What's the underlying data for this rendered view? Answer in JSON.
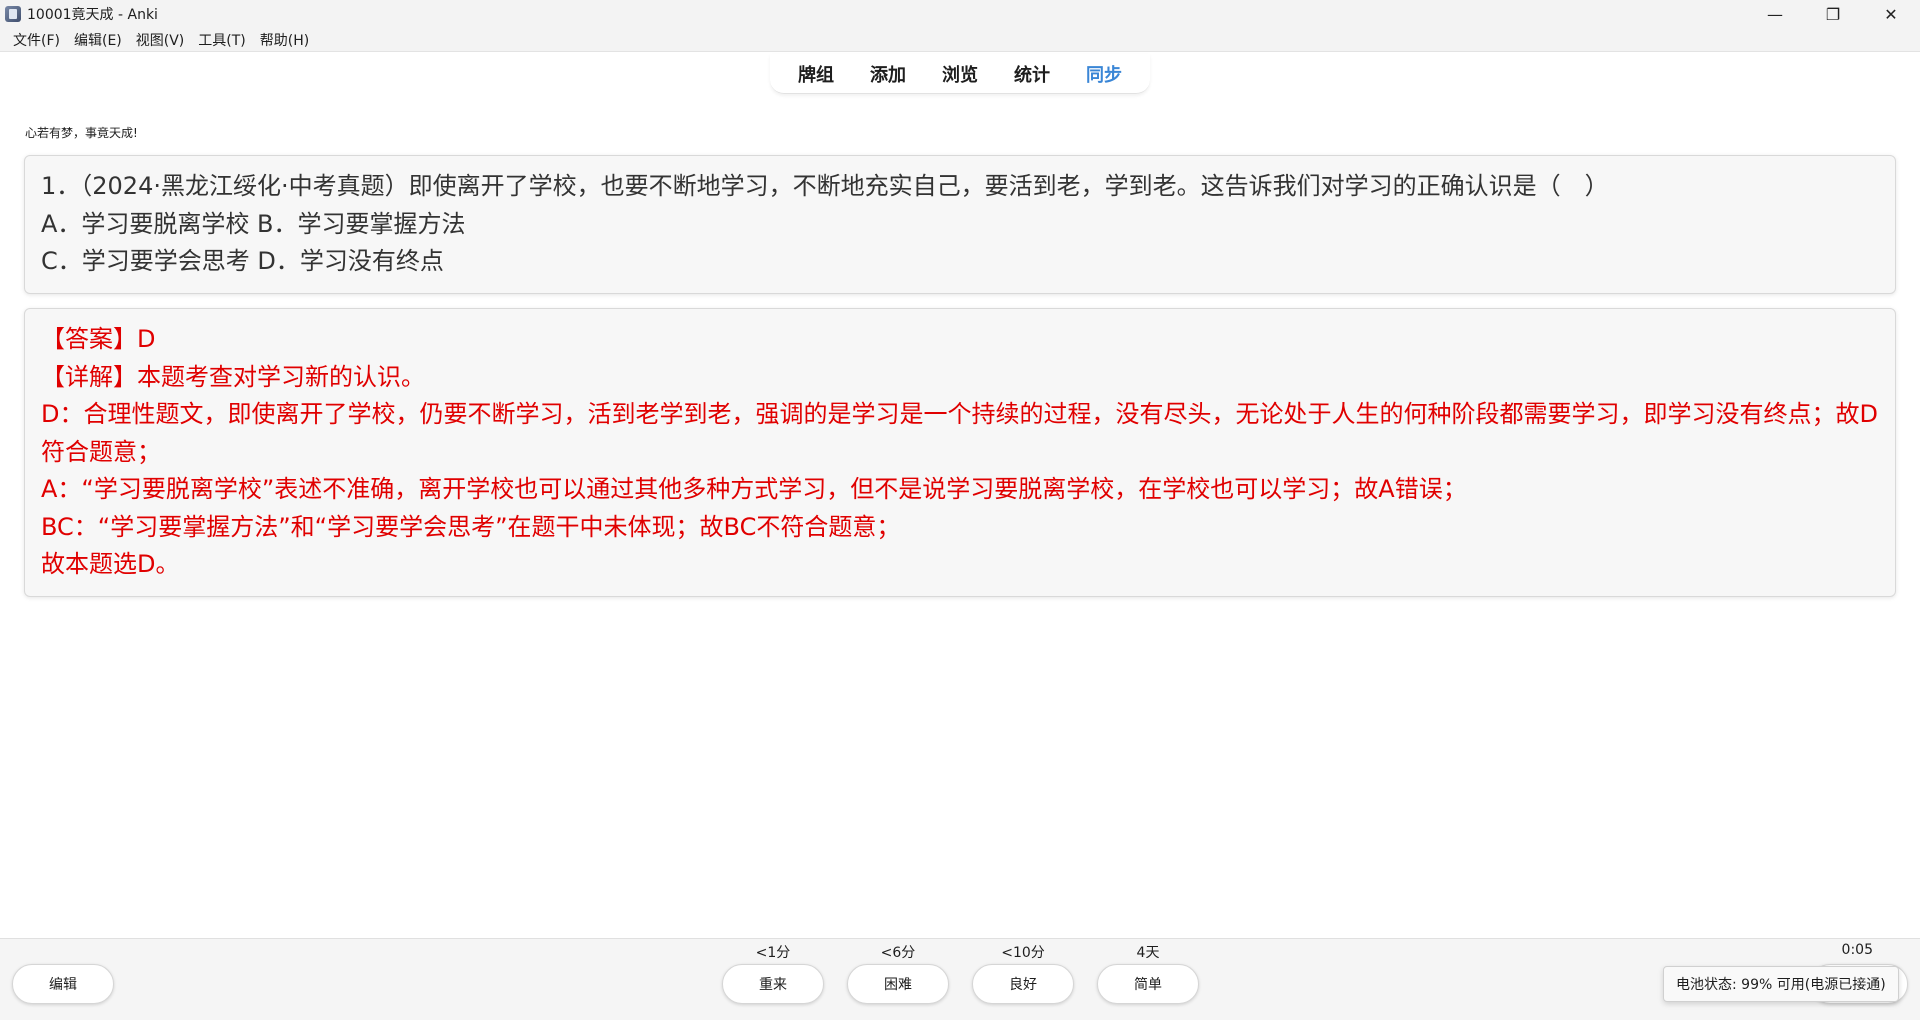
{
  "window": {
    "title": "10001竟天成 - Anki",
    "controls": {
      "minimize": "—",
      "restore": "❐",
      "close": "✕"
    }
  },
  "menu": [
    "文件(F)",
    "编辑(E)",
    "视图(V)",
    "工具(T)",
    "帮助(H)"
  ],
  "toolbar": {
    "items": [
      {
        "label": "牌组",
        "active": false
      },
      {
        "label": "添加",
        "active": false
      },
      {
        "label": "浏览",
        "active": false
      },
      {
        "label": "统计",
        "active": false
      },
      {
        "label": "同步",
        "active": true
      }
    ],
    "active_color": "#3a86d6"
  },
  "tagline": "心若有梦，事竟天成!",
  "question": {
    "lines": [
      "1．（2024·黑龙江绥化·中考真题）即使离开了学校，也要不断地学习，不断地充实自己，要活到老，学到老。这告诉我们对学习的正确认识是（　）",
      "A．学习要脱离学校 B．学习要掌握方法",
      "C．学习要学会思考 D．学习没有终点"
    ]
  },
  "answer": {
    "color": "#e00000",
    "lines": [
      "【答案】D",
      "【详解】本题考查对学习新的认识。",
      "D：合理性题文，即使离开了学校，仍要不断学习，活到老学到老，强调的是学习是一个持续的过程，没有尽头，无论处于人生的何种阶段都需要学习，即学习没有终点；故D符合题意；",
      "A：“学习要脱离学校”表述不准确，离开学校也可以通过其他多种方式学习，但不是说学习要脱离学校，在学校也可以学习；故A错误；",
      "BC：“学习要掌握方法”和“学习要学会思考”在题干中未体现；故BC不符合题意；",
      "故本题选D。"
    ]
  },
  "bottom": {
    "edit_label": "编辑",
    "answers": [
      {
        "label": "重来",
        "interval": "<1分"
      },
      {
        "label": "困难",
        "interval": "<6分"
      },
      {
        "label": "良好",
        "interval": "<10分"
      },
      {
        "label": "简单",
        "interval": "4天"
      }
    ],
    "timer": "0:05",
    "tooltip": "电池状态: 99% 可用(电源已接通)"
  }
}
